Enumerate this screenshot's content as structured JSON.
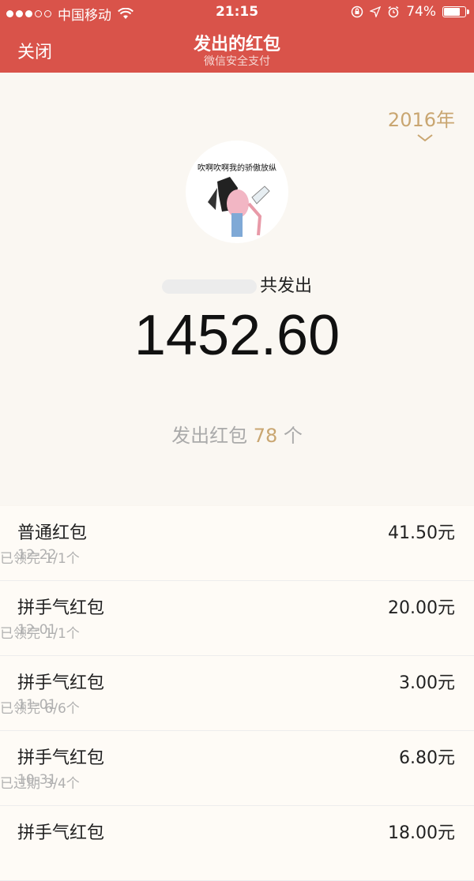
{
  "status_bar": {
    "carrier": "中国移动",
    "time": "21:15",
    "battery": "74%"
  },
  "nav": {
    "close_label": "关闭",
    "title": "发出的红包",
    "subtitle": "微信安全支付"
  },
  "summary": {
    "year": "2016年",
    "avatar_caption": "吹啊吹啊我的骄傲放纵",
    "sent_suffix": "共发出",
    "total_amount": "1452.60",
    "count_prefix": "发出红包",
    "count_value": "78",
    "count_suffix": "个"
  },
  "colors": {
    "header": "#d9534a",
    "accent": "#c9a671"
  },
  "envelopes": [
    {
      "type": "普通红包",
      "date": "12-22",
      "amount": "41.50元",
      "status": "已领完 1/1个"
    },
    {
      "type": "拼手气红包",
      "date": "12-01",
      "amount": "20.00元",
      "status": "已领完 1/1个"
    },
    {
      "type": "拼手气红包",
      "date": "11-01",
      "amount": "3.00元",
      "status": "已领完 6/6个"
    },
    {
      "type": "拼手气红包",
      "date": "10-31",
      "amount": "6.80元",
      "status": "已过期 3/4个"
    },
    {
      "type": "拼手气红包",
      "date": "",
      "amount": "18.00元",
      "status": ""
    }
  ]
}
